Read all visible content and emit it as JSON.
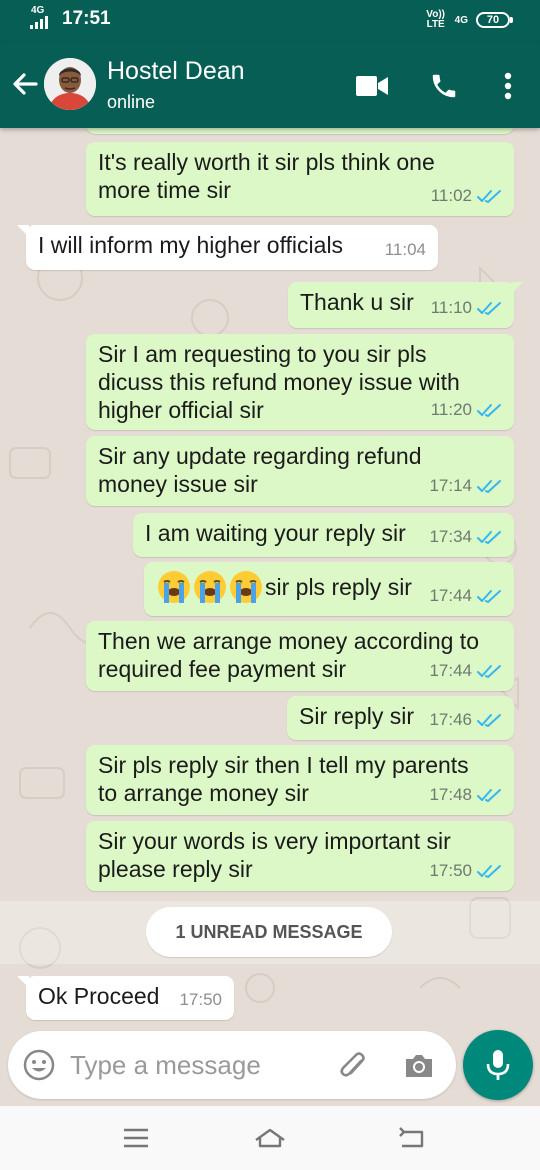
{
  "status_bar": {
    "network": "4G",
    "time": "17:51",
    "volte": "Vo)) LTE",
    "network_right": "4G",
    "battery": "70"
  },
  "header": {
    "contact_name": "Hostel Dean",
    "contact_status": "online",
    "colors": {
      "primary": "#075e54",
      "outgoing": "#dcf8c6",
      "incoming": "#ffffff",
      "read_tick": "#34b7f1",
      "fab": "#00897b"
    }
  },
  "messages": [
    {
      "text_lines": [
        "It's really worth it sir pls think one",
        "more time sir"
      ],
      "time": "11:02",
      "direction": "out",
      "status": "read"
    },
    {
      "text_lines": [
        "I will inform my higher officials"
      ],
      "time": "11:04",
      "direction": "in"
    },
    {
      "text_lines": [
        "Thank u sir"
      ],
      "time": "11:10",
      "direction": "out",
      "status": "read"
    },
    {
      "text_lines": [
        "Sir I am requesting to you  sir pls",
        "dicuss this refund money issue with",
        "higher official sir"
      ],
      "time": "11:20",
      "direction": "out",
      "status": "read"
    },
    {
      "text_lines": [
        "Sir any update regarding refund",
        "money issue sir"
      ],
      "time": "17:14",
      "direction": "out",
      "status": "read"
    },
    {
      "text_lines": [
        "I am waiting your reply sir"
      ],
      "time": "17:34",
      "direction": "out",
      "status": "read"
    },
    {
      "text_lines": [
        "sir pls reply sir"
      ],
      "emoji": [
        "loudly-crying-face",
        "loudly-crying-face",
        "loudly-crying-face"
      ],
      "time": "17:44",
      "direction": "out",
      "status": "read"
    },
    {
      "text_lines": [
        "Then we arrange money according to",
        "required fee payment sir"
      ],
      "time": "17:44",
      "direction": "out",
      "status": "read"
    },
    {
      "text_lines": [
        "Sir reply sir"
      ],
      "time": "17:46",
      "direction": "out",
      "status": "read"
    },
    {
      "text_lines": [
        "Sir pls reply sir then I tell my parents",
        "to arrange money sir"
      ],
      "time": "17:48",
      "direction": "out",
      "status": "read"
    },
    {
      "text_lines": [
        "Sir your words is very important sir",
        "please reply sir"
      ],
      "time": "17:50",
      "direction": "out",
      "status": "read"
    },
    {
      "text_lines": [
        "Ok Proceed"
      ],
      "time": "17:50",
      "direction": "in"
    }
  ],
  "unread_label": "1 UNREAD MESSAGE",
  "composer": {
    "placeholder": "Type a message",
    "value": ""
  },
  "icons": {
    "header": [
      "back-arrow-icon",
      "video-call-icon",
      "voice-call-icon",
      "more-options-icon"
    ],
    "composer": [
      "emoji-icon",
      "attach-icon",
      "camera-icon",
      "mic-icon"
    ],
    "navigation": [
      "menu-icon",
      "home-icon",
      "back-icon"
    ]
  }
}
